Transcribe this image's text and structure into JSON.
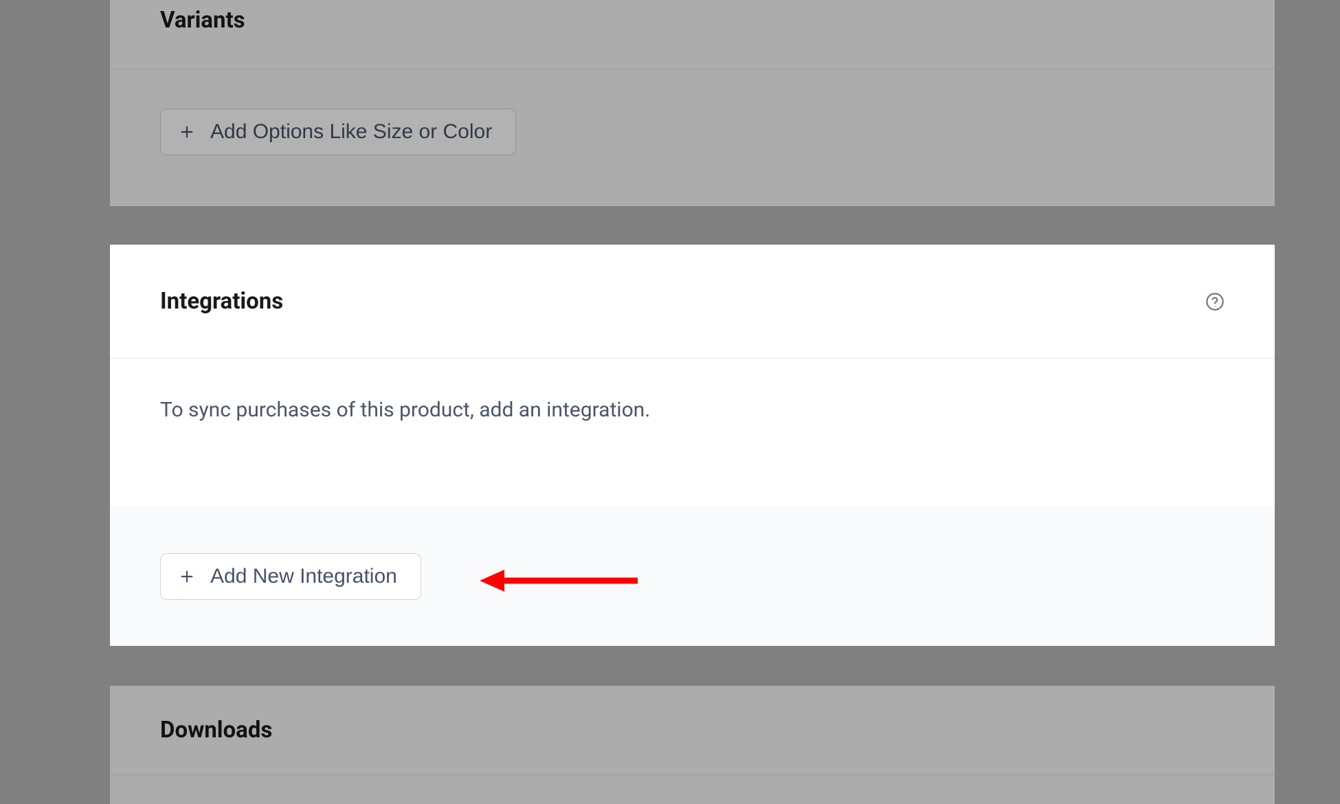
{
  "variants": {
    "title": "Variants",
    "add_options_label": "Add Options Like Size or Color"
  },
  "integrations": {
    "title": "Integrations",
    "help_icon": "help-circle-icon",
    "description": "To sync purchases of this product, add an integration.",
    "add_button_label": "Add New Integration"
  },
  "downloads": {
    "title": "Downloads"
  },
  "annotation": {
    "arrow_color": "#ff0000"
  }
}
